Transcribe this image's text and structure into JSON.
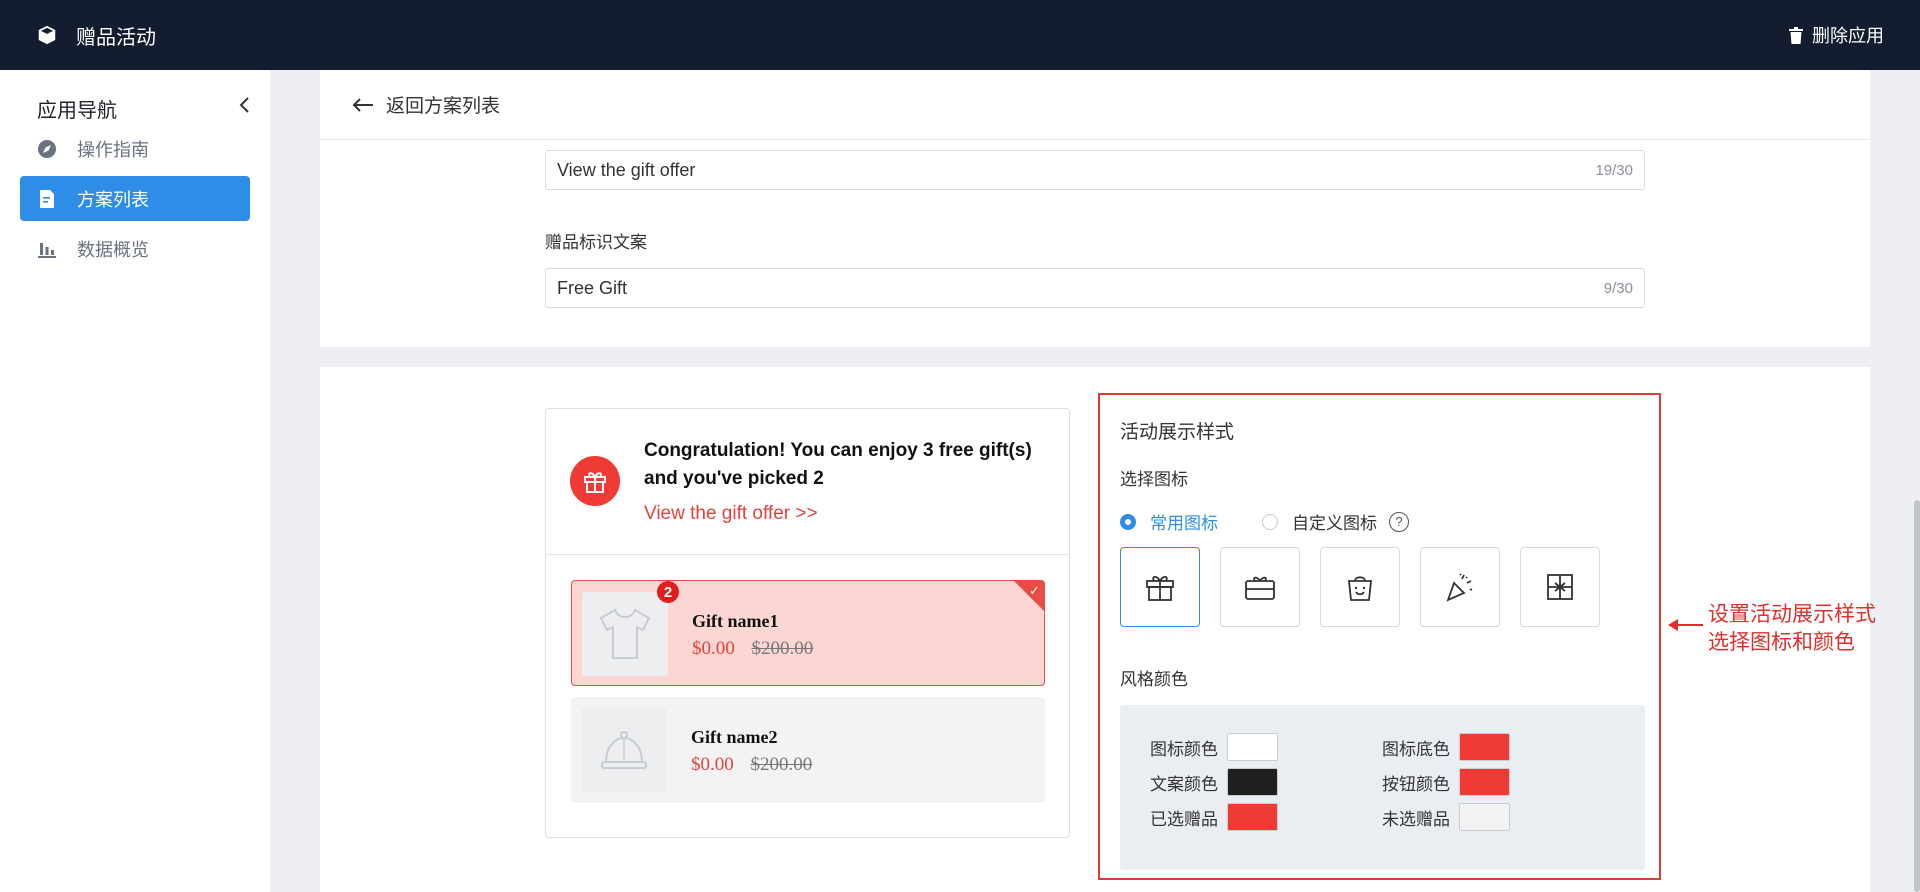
{
  "app": {
    "title": "赠品活动",
    "delete_label": "删除应用"
  },
  "sidebar": {
    "title": "应用导航",
    "items": [
      {
        "label": "操作指南",
        "icon": "compass-icon",
        "active": false
      },
      {
        "label": "方案列表",
        "icon": "document-icon",
        "active": true
      },
      {
        "label": "数据概览",
        "icon": "bar-chart-icon",
        "active": false
      }
    ]
  },
  "header": {
    "back_label": "返回方案列表"
  },
  "form": {
    "button_text": {
      "value": "View the gift offer",
      "count": "19/30"
    },
    "gift_tag": {
      "label": "赠品标识文案",
      "value": "Free Gift",
      "count": "9/30"
    }
  },
  "preview": {
    "title": "Congratulation! You can enjoy 3 free gift(s) and you've picked 2",
    "link": "View the gift offer >>",
    "gifts": [
      {
        "name": "Gift name1",
        "price": "$0.00",
        "original": "$200.00",
        "badge": "2",
        "selected": true
      },
      {
        "name": "Gift name2",
        "price": "$0.00",
        "original": "$200.00",
        "selected": false
      }
    ]
  },
  "settings": {
    "title": "活动展示样式",
    "icon_section": "选择图标",
    "radio_common": "常用图标",
    "radio_custom": "自定义图标",
    "help": "?",
    "color_section": "风格颜色",
    "colors": [
      {
        "label": "图标颜色",
        "value": "#ffffff"
      },
      {
        "label": "图标底色",
        "value": "#ef3b33"
      },
      {
        "label": "文案颜色",
        "value": "#1f1f1f"
      },
      {
        "label": "按钮颜色",
        "value": "#ef3b33"
      },
      {
        "label": "已选赠品",
        "value": "#ef3b33"
      },
      {
        "label": "未选赠品",
        "value": "#f2f2f2"
      }
    ]
  },
  "annotation": {
    "line1": "设置活动展示样式",
    "line2": "选择图标和颜色"
  }
}
